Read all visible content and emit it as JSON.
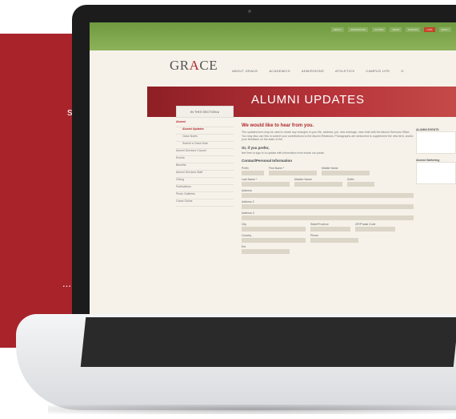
{
  "left_panel": {
    "fragment_top": "s",
    "fragment_bottom": "..."
  },
  "site": {
    "logo_prefix": "GR",
    "logo_accent": "A",
    "logo_suffix": "CE",
    "util_links": [
      "ABOUT",
      "ADMISSIONS",
      "ALUMNI",
      "NEWS",
      "EVENTS",
      "GIVE",
      "APPLY"
    ],
    "nav": [
      "ABOUT GRACE",
      "ACADEMICS",
      "ADMISSIONS",
      "ATHLETICS",
      "CAMPUS LIFE",
      "G"
    ],
    "section_tab": "IN THIS SECTION ▸",
    "page_title": "ALUMNI UPDATES",
    "sidebar": [
      {
        "label": "Alumni",
        "active": true,
        "sub": false
      },
      {
        "label": "Alumni Updates",
        "active": true,
        "sub": true
      },
      {
        "label": "Class Notes",
        "active": false,
        "sub": true
      },
      {
        "label": "Submit a Class Note",
        "active": false,
        "sub": true
      },
      {
        "label": "Alumni Services Council",
        "active": false,
        "sub": false
      },
      {
        "label": "Events",
        "active": false,
        "sub": false
      },
      {
        "label": "Benefits",
        "active": false,
        "sub": false
      },
      {
        "label": "Alumni Services Staff",
        "active": false,
        "sub": false
      },
      {
        "label": "Giving",
        "active": false,
        "sub": false
      },
      {
        "label": "Publications",
        "active": false,
        "sub": false
      },
      {
        "label": "Photo Galleries",
        "active": false,
        "sub": false
      },
      {
        "label": "Grace Online",
        "active": false,
        "sub": false
      }
    ],
    "heading": "We would like to hear from you.",
    "intro": "The updates form may be used to share any changes in your life, address, job, new marriage, new child with the Alumni Services Office. You may also use this to submit your contributions to the Alumni Relations. Photographs are welcomed to supplement the new item, and/or your feedback on the state of the.",
    "login_heading": "Or, if you prefer,",
    "login_text": "feel free to sign in to update with information from inside our portal.",
    "form_heading": "Contact/Personal Information",
    "field_labels": {
      "prefix": "Prefix",
      "first_name": "First Name *",
      "middle_name": "Middle Name",
      "last_name": "Last Name *",
      "maiden_name": "Maiden Name",
      "suffix": "Suffix",
      "address": "Address",
      "address2": "Address 2",
      "address3": "Address 3",
      "city": "City",
      "state": "State/Province",
      "zip": "ZIP/Postal Code",
      "country": "Country",
      "phone": "Phone",
      "ext": "Ext"
    },
    "aside": {
      "title1": "ALUMNI EVENTS",
      "title2": "Alumni Gathering"
    }
  }
}
